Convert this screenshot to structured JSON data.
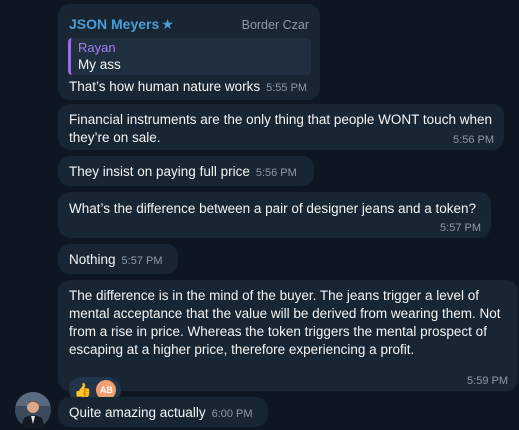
{
  "messages": {
    "m1": {
      "sender": "JSON Meyers",
      "sender_title": "Border Czar",
      "reply_author": "Rayan",
      "reply_text": "My ass",
      "text": "That’s how human nature works",
      "time": "5:55 PM"
    },
    "m2": {
      "line1": "Financial instruments are the only thing that people WONT touch when",
      "line2": "they’re on sale.",
      "time": "5:56 PM"
    },
    "m3": {
      "text": "They insist on paying full price",
      "time": "5:56 PM"
    },
    "m4": {
      "text": "What’s the difference between a pair of designer jeans and a token?",
      "time": "5:57 PM"
    },
    "m5": {
      "text": "Nothing",
      "time": "5:57 PM"
    },
    "m6": {
      "line1": "The difference is in the mind of the buyer. The jeans trigger a level of",
      "line2": "mental acceptance that the value will be derived from wearing them. Not",
      "line3": "from a rise in price. Whereas the token triggers the mental prospect  of",
      "line4": "escaping at a higher price, therefore experiencing a profit.",
      "reaction_emoji": "👍",
      "reactor_initials": "AB",
      "time": "5:59 PM"
    },
    "m7": {
      "text": "Quite amazing actually",
      "time": "6:00 PM"
    }
  },
  "colors": {
    "background": "#0e1621",
    "bubble": "#182533",
    "sender_name": "#4a9ed8",
    "reply_bar": "#9b6fe0",
    "timestamp": "#8b9aab"
  },
  "icons": {
    "admin_badge": "star-icon",
    "reaction": "thumbs-up-icon"
  }
}
